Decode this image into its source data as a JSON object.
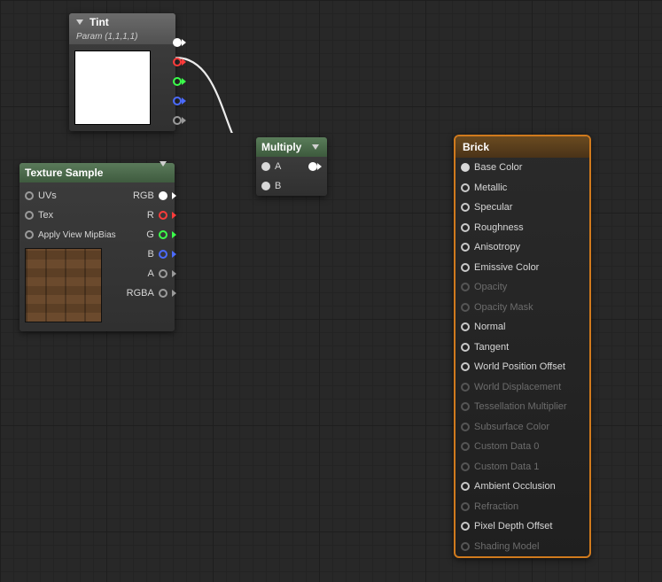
{
  "tint": {
    "title": "Tint",
    "subtitle": "Param (1,1,1,1)",
    "swatch": "#ffffff"
  },
  "texture": {
    "title": "Texture Sample",
    "inputs": [
      "UVs",
      "Tex",
      "Apply View MipBias"
    ],
    "outputs": [
      "RGB",
      "R",
      "G",
      "B",
      "A",
      "RGBA"
    ]
  },
  "multiply": {
    "title": "Multiply",
    "inputs": [
      "A",
      "B"
    ]
  },
  "brick": {
    "title": "Brick",
    "pins": [
      {
        "label": "Base Color",
        "enabled": true
      },
      {
        "label": "Metallic",
        "enabled": true
      },
      {
        "label": "Specular",
        "enabled": true
      },
      {
        "label": "Roughness",
        "enabled": true
      },
      {
        "label": "Anisotropy",
        "enabled": true
      },
      {
        "label": "Emissive Color",
        "enabled": true
      },
      {
        "label": "Opacity",
        "enabled": false
      },
      {
        "label": "Opacity Mask",
        "enabled": false
      },
      {
        "label": "Normal",
        "enabled": true
      },
      {
        "label": "Tangent",
        "enabled": true
      },
      {
        "label": "World Position Offset",
        "enabled": true
      },
      {
        "label": "World Displacement",
        "enabled": false
      },
      {
        "label": "Tessellation Multiplier",
        "enabled": false
      },
      {
        "label": "Subsurface Color",
        "enabled": false
      },
      {
        "label": "Custom Data 0",
        "enabled": false
      },
      {
        "label": "Custom Data 1",
        "enabled": false
      },
      {
        "label": "Ambient Occlusion",
        "enabled": true
      },
      {
        "label": "Refraction",
        "enabled": false
      },
      {
        "label": "Pixel Depth Offset",
        "enabled": true
      },
      {
        "label": "Shading Model",
        "enabled": false
      }
    ]
  }
}
